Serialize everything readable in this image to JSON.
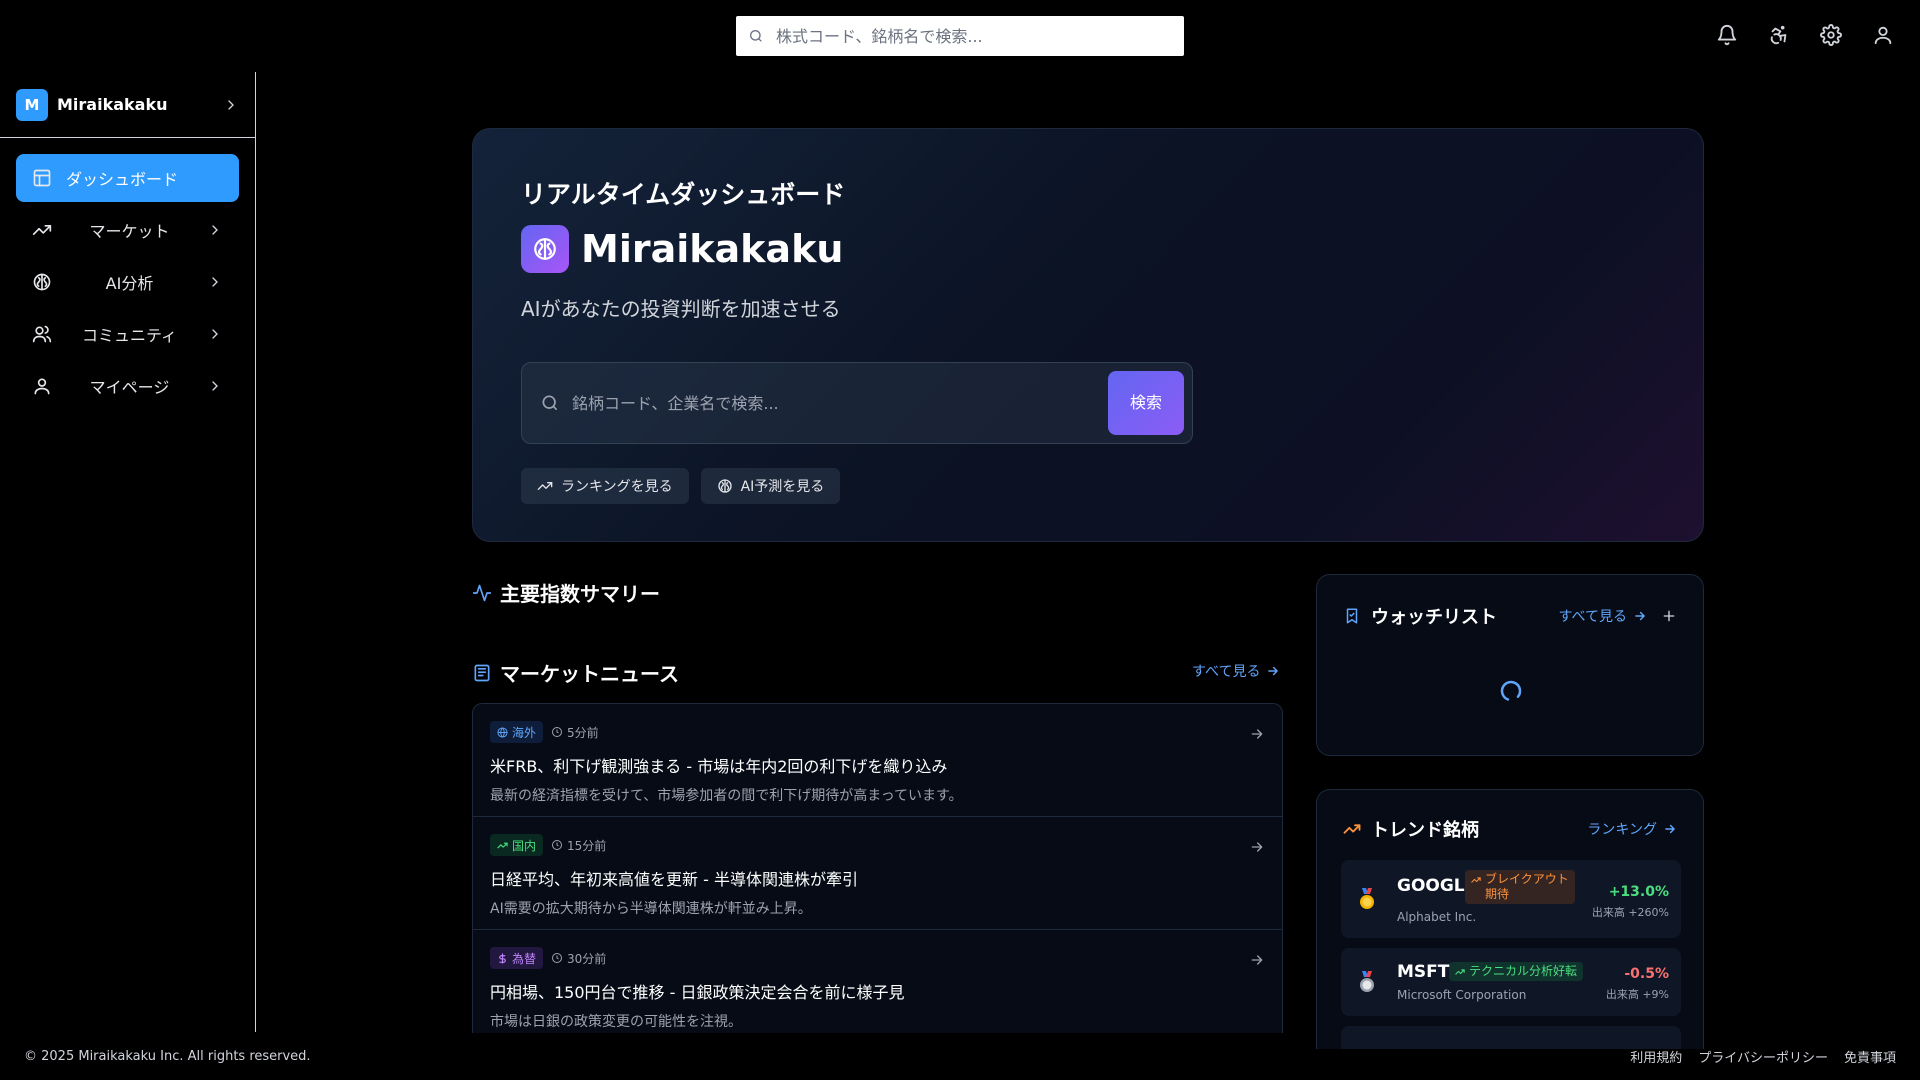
{
  "topbar": {
    "search_placeholder": "株式コード、銘柄名で検索...",
    "icons": [
      "bell-icon",
      "accessibility-icon",
      "settings-icon",
      "user-icon"
    ]
  },
  "sidebar": {
    "brand_initial": "M",
    "brand_name": "Miraikakaku",
    "items": [
      {
        "label": "ダッシュボード",
        "icon": "dashboard-icon",
        "active": true
      },
      {
        "label": "マーケット",
        "icon": "trending-up-icon"
      },
      {
        "label": "AI分析",
        "icon": "brain-icon"
      },
      {
        "label": "コミュニティ",
        "icon": "users-icon"
      },
      {
        "label": "マイページ",
        "icon": "user-icon"
      }
    ]
  },
  "hero": {
    "subtitle": "リアルタイムダッシュボード",
    "title": "Miraikakaku",
    "tagline": "AIがあなたの投資判断を加速させる",
    "search_placeholder": "銘柄コード、企業名で検索...",
    "search_button": "検索",
    "actions": [
      {
        "label": "ランキングを見る",
        "icon": "trending-up-icon"
      },
      {
        "label": "AI予測を見る",
        "icon": "brain-icon"
      }
    ]
  },
  "summary": {
    "title": "主要指数サマリー"
  },
  "news": {
    "title": "マーケットニュース",
    "view_all": "すべて見る",
    "items": [
      {
        "tag": "海外",
        "time": "5分前",
        "headline": "米FRB、利下げ観測強まる - 市場は年内2回の利下げを織り込み",
        "desc": "最新の経済指標を受けて、市場参加者の間で利下げ期待が高まっています。"
      },
      {
        "tag": "国内",
        "time": "15分前",
        "headline": "日経平均、年初来高値を更新 - 半導体関連株が牽引",
        "desc": "AI需要の拡大期待から半導体関連株が軒並み上昇。"
      },
      {
        "tag": "為替",
        "time": "30分前",
        "headline": "円相場、150円台で推移 - 日銀政策決定会合を前に様子見",
        "desc": "市場は日銀の政策変更の可能性を注視。"
      }
    ]
  },
  "watchlist": {
    "title": "ウォッチリスト",
    "view_all": "すべて見る"
  },
  "trending": {
    "title": "トレンド銘柄",
    "link": "ランキング",
    "items": [
      {
        "rank_icon": "gold-medal-icon",
        "symbol": "GOOGL",
        "company": "Alphabet Inc.",
        "tag": "ブレイクアウト期待",
        "change": "+13.0%",
        "volume": "出来高 +260%",
        "direction": "up"
      },
      {
        "rank_icon": "silver-medal-icon",
        "symbol": "MSFT",
        "company": "Microsoft Corporation",
        "tag": "テクニカル分析好転",
        "change": "-0.5%",
        "volume": "出来高 +9%",
        "direction": "down"
      }
    ]
  },
  "footer": {
    "copyright": "© 2025 Miraikakaku Inc. All rights reserved.",
    "links": [
      "利用規約",
      "プライバシーポリシー",
      "免責事項"
    ]
  },
  "colors": {
    "accent": "#2f9bff",
    "link": "#60a5fa",
    "positive": "#4ade80",
    "negative": "#f87171",
    "hero_gradient_start": "#6366f1",
    "hero_gradient_end": "#8b5cf6"
  }
}
